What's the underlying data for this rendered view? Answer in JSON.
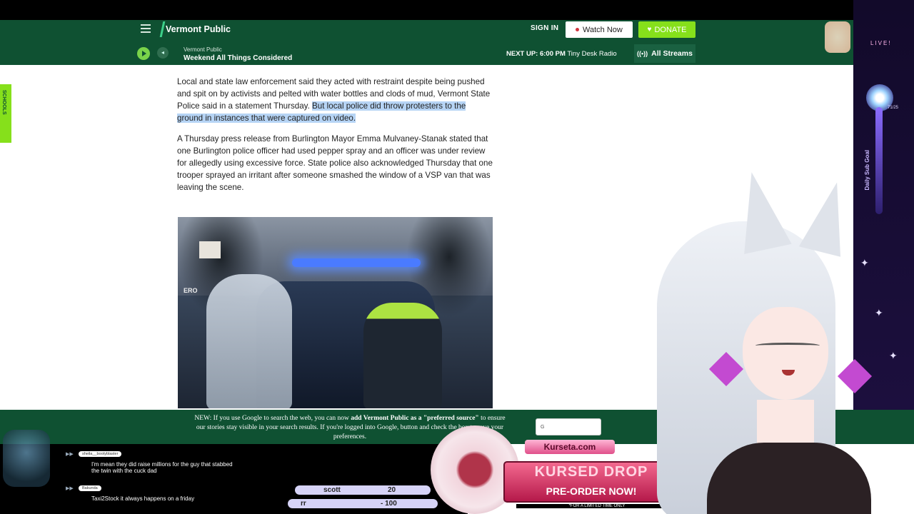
{
  "header": {
    "logo": "Vermont Public",
    "signin": "SIGN IN",
    "watch_now": "Watch Now",
    "donate": "DONATE",
    "stream_source": "Vermont Public",
    "stream_show": "Weekend All Things Considered",
    "next_up_label": "NEXT UP:",
    "next_up_time": "6:00 PM",
    "next_up_show": "Tiny Desk Radio",
    "all_streams": "All Streams"
  },
  "sidetab": {
    "label": "SCHOOLS"
  },
  "article": {
    "p1_plain": "Local and state law enforcement said they acted with restraint despite being pushed and spit on by activists and pelted with water bottles and clods of mud, Vermont State Police said in a statement Thursday. ",
    "p1_highlight": "But local police did throw protesters to the ground in instances that were captured on video.",
    "p2": "A Thursday press release from Burlington Mayor Emma Mulvaney-Stanak stated that one Burlington police officer had used pepper spray and an officer was under review for allegedly using excessive force. State police also acknowledged Thursday that one trooper sprayed an irritant after someone smashed the window of a VSP van that was leaving the scene."
  },
  "photo": {
    "sign_text": "ERO"
  },
  "banner": {
    "prefix": "NEW: If you use Google to search the web, you can now ",
    "bold": "add Vermont Public as a \"preferred source\"",
    "rest": " to ensure our stories stay visible in your search results. If you're logged into Google, ",
    "end": "button and check the box to save your preferences."
  },
  "chat": [
    {
      "name": "sheila__bootyblaster",
      "text": "I'm mean they did raise millions for the guy that stabbed the twin with the cuck dad"
    },
    {
      "name": "Bakunda",
      "text": "Taxi2Stock it always happens on a friday"
    }
  ],
  "subs": {
    "pill1_name": "scott",
    "pill1_value": "20",
    "pill2_name": "rr",
    "pill2_value": "- 100"
  },
  "promo": {
    "site": "Kurseta.com",
    "title": "KURSED DROP",
    "subtitle": "PRE-ORDER NOW!",
    "limited": "*FOR A LIMITED TIME ONLY"
  },
  "deco": {
    "live": "LIVE!",
    "goal": "Daily Sub Goal",
    "count": "71/25"
  },
  "colors": {
    "brand_green": "#0f5132",
    "accent_lime": "#86e01b",
    "highlight": "#b6d4f5"
  }
}
